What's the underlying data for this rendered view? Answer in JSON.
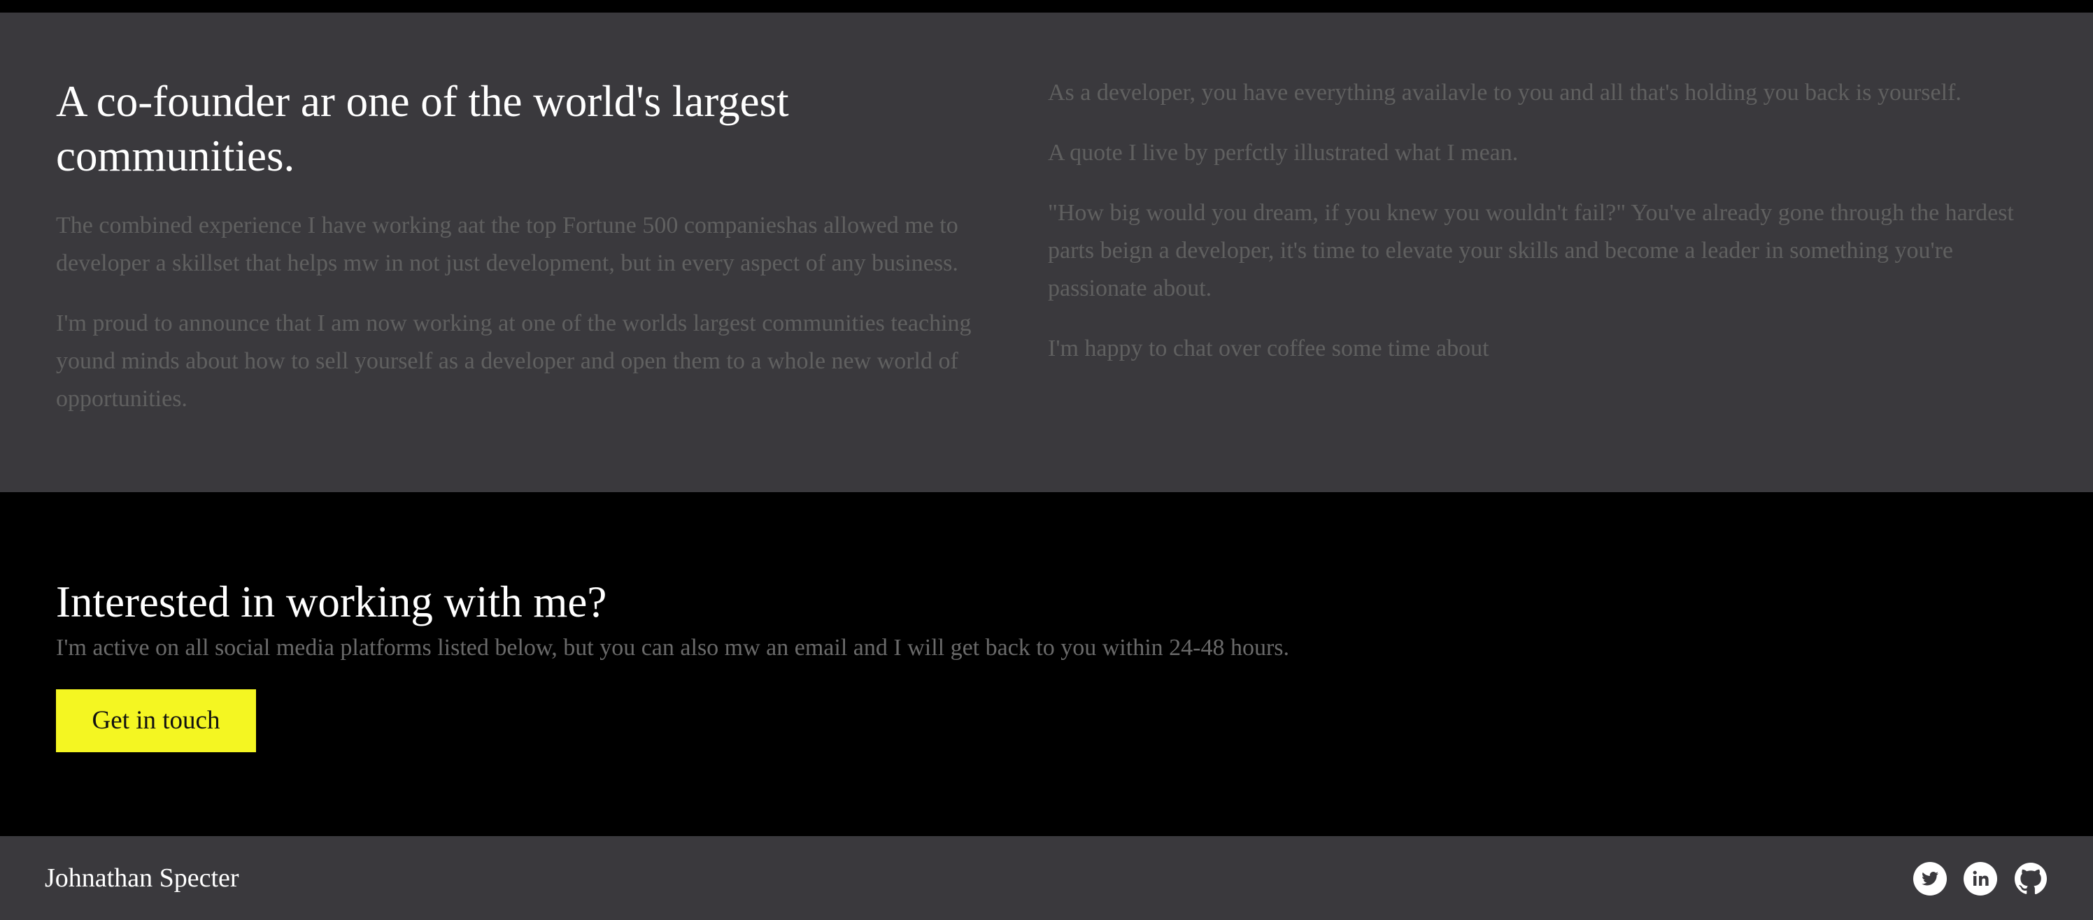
{
  "about": {
    "heading": "A co-founder ar one of the world's largest communities.",
    "left_paragraphs": [
      "The combined experience I have working aat the top Fortune 500 companieshas allowed me to developer a skillset that helps mw in not just development, but in every aspect of any business.",
      "I'm proud to announce that I am now working at one of the worlds largest communities teaching yound minds about how to sell yourself as a developer and open them to a whole new world of opportunities."
    ],
    "right_paragraphs": [
      "As a developer, you have everything availavle to you and all that's holding you back is yourself.",
      "A quote I live by perfctly illustrated what I mean.",
      "\"How big would you dream, if you knew you wouldn't fail?\" You've already gone through the hardest parts beign a developer, it's time to elevate your skills and become a leader in something you're passionate about.",
      "I'm happy to chat over coffee some time about"
    ]
  },
  "cta": {
    "title": "Interested in working with me?",
    "text": "I'm active on all social media platforms listed below, but you can also mw an email and I will get back to you within 24-48 hours.",
    "button_label": "Get in touch"
  },
  "footer": {
    "name": "Johnathan Specter",
    "social_icons": [
      "twitter-icon",
      "linkedin-icon",
      "github-icon"
    ]
  },
  "colors": {
    "accent": "#f4f622",
    "panel": "#3a393d",
    "background": "#000000"
  }
}
